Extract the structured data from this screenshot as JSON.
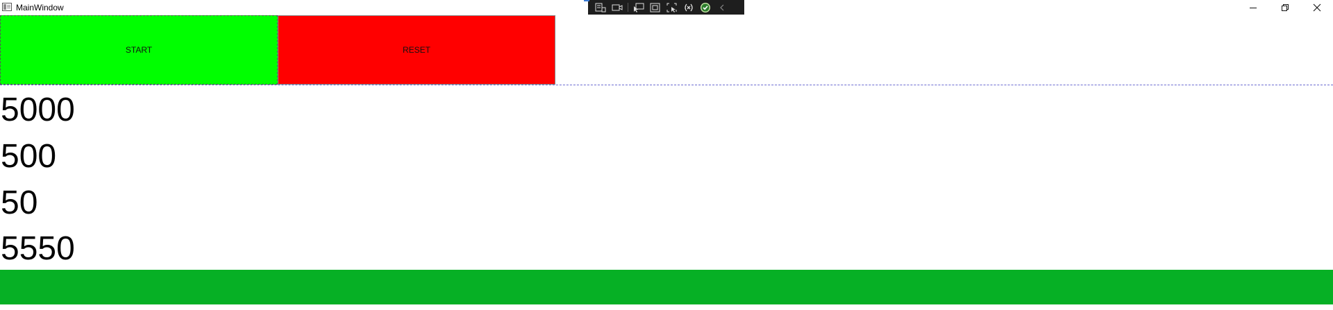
{
  "window": {
    "title": "MainWindow",
    "controls": {
      "minimize": "minimize-icon",
      "restore": "restore-icon",
      "close": "close-icon"
    }
  },
  "debug_toolbar": {
    "icons": [
      "live-visual-tree-icon",
      "record-icon",
      "select-element-icon",
      "display-layout-adorners-icon",
      "track-focus-icon",
      "binding-failures-icon",
      "hot-reload-ok-icon",
      "collapse-icon"
    ]
  },
  "buttons": {
    "start_label": "START",
    "reset_label": "RESET",
    "start_color": "#00ff00",
    "reset_color": "#ff0000"
  },
  "values": [
    "5000",
    "500",
    "50",
    "5550"
  ],
  "progress": {
    "value_percent": 100,
    "color": "#06b025"
  }
}
